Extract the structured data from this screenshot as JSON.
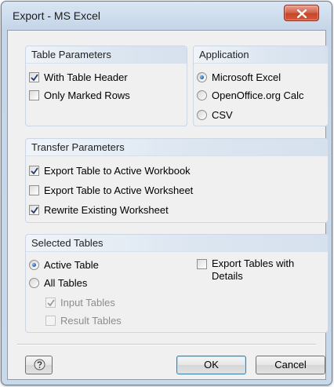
{
  "window": {
    "title": "Export - MS Excel"
  },
  "table_parameters": {
    "heading": "Table Parameters",
    "with_table_header": {
      "label": "With Table Header",
      "checked": true
    },
    "only_marked_rows": {
      "label": "Only Marked Rows",
      "checked": false
    }
  },
  "application": {
    "heading": "Application",
    "options": [
      {
        "label": "Microsoft Excel",
        "selected": true
      },
      {
        "label": "OpenOffice.org Calc",
        "selected": false
      },
      {
        "label": "CSV",
        "selected": false
      }
    ]
  },
  "transfer_parameters": {
    "heading": "Transfer Parameters",
    "export_to_active_workbook": {
      "label": "Export Table to Active Workbook",
      "checked": true
    },
    "export_to_active_worksheet": {
      "label": "Export Table to Active Worksheet",
      "checked": false
    },
    "rewrite_existing_worksheet": {
      "label": "Rewrite Existing Worksheet",
      "checked": true
    }
  },
  "selected_tables": {
    "heading": "Selected Tables",
    "active_table": {
      "label": "Active Table",
      "selected": true
    },
    "all_tables": {
      "label": "All Tables",
      "selected": false
    },
    "input_tables": {
      "label": "Input Tables",
      "checked": true,
      "enabled": false
    },
    "result_tables": {
      "label": "Result Tables",
      "checked": false,
      "enabled": false
    },
    "export_with_details": {
      "label_line1": "Export Tables with",
      "label_line2": "Details",
      "checked": false
    }
  },
  "buttons": {
    "ok": "OK",
    "cancel": "Cancel",
    "help_icon": "help-icon"
  },
  "colors": {
    "close_button": "#c7452b",
    "group_header": "#dce6f1",
    "radio_dot": "#1d5fb5"
  }
}
